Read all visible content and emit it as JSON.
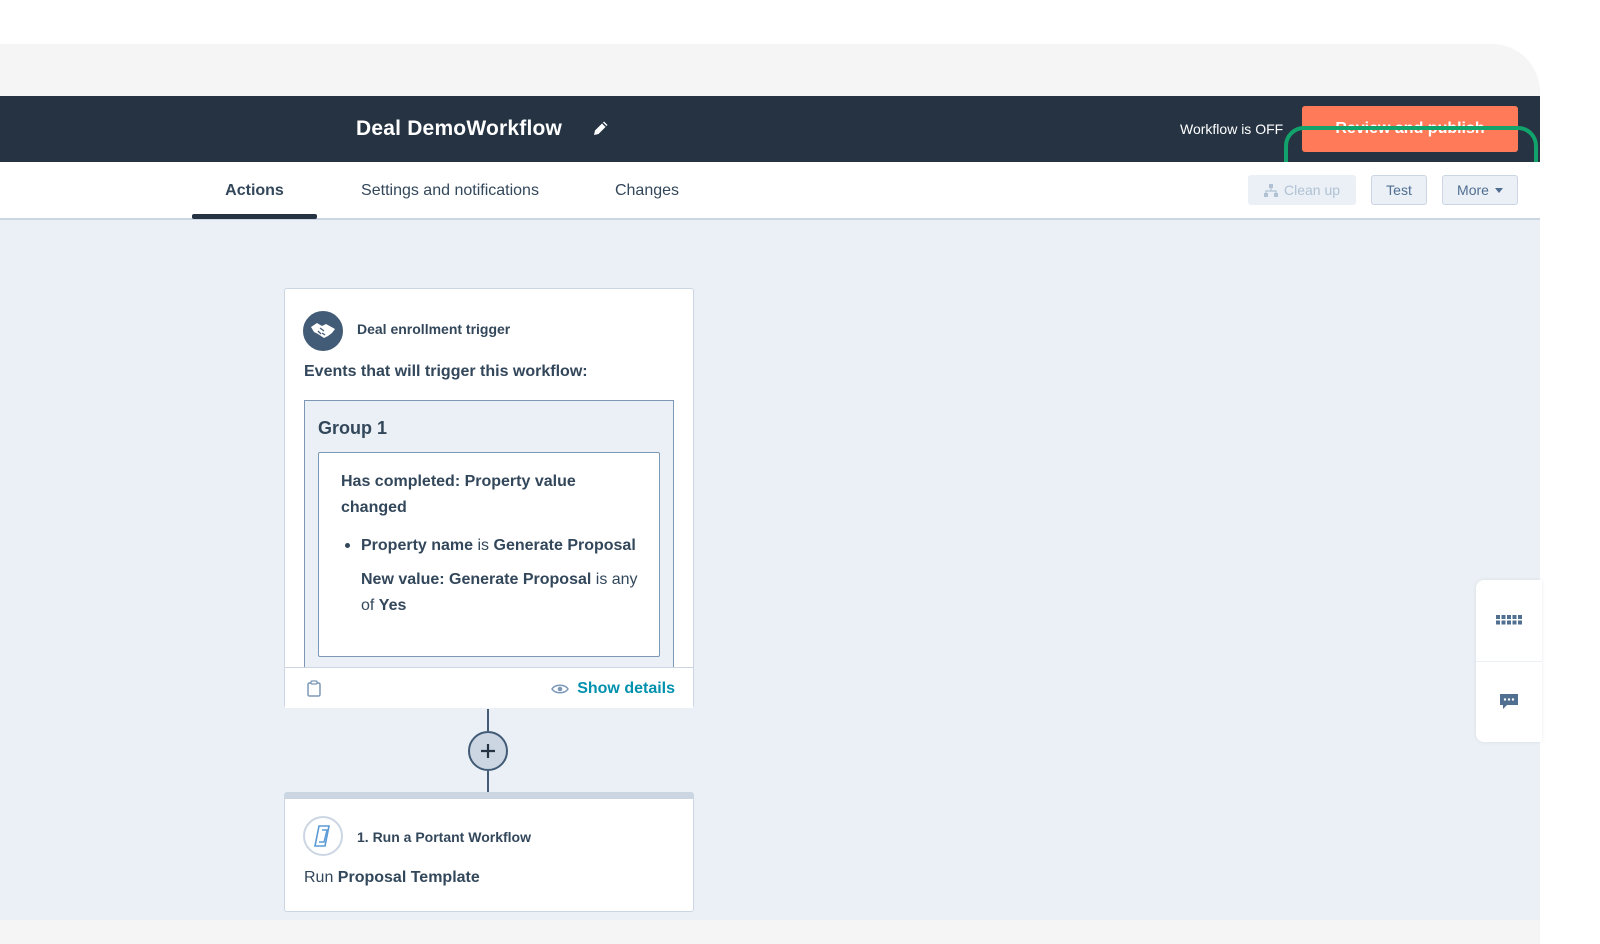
{
  "header": {
    "workflow_title": "Deal DemoWorkflow",
    "status_text": "Workflow is OFF",
    "publish_label": "Review and publish"
  },
  "tabs": [
    {
      "label": "Actions",
      "active": true
    },
    {
      "label": "Settings and notifications",
      "active": false
    },
    {
      "label": "Changes",
      "active": false
    }
  ],
  "toolbar": {
    "cleanup_label": "Clean up",
    "test_label": "Test",
    "more_label": "More"
  },
  "trigger_card": {
    "label": "Deal enrollment trigger",
    "events_heading": "Events that will trigger this workflow:",
    "group_title": "Group 1",
    "condition_title": "Has completed: Property value changed",
    "row1": {
      "a": "Property name",
      "b": " is ",
      "c": "Generate Proposal"
    },
    "row2": {
      "a": "New value: Generate Proposal",
      "b": " is any of ",
      "c": "Yes"
    },
    "show_details_label": "Show details"
  },
  "action_card": {
    "label": "1. Run a Portant Workflow",
    "text_prefix": "Run ",
    "text_value": "Proposal Template"
  },
  "colors": {
    "topbar": "#253342",
    "publish": "#ff7a59",
    "highlight": "#12a36c",
    "link": "#0091ae"
  }
}
